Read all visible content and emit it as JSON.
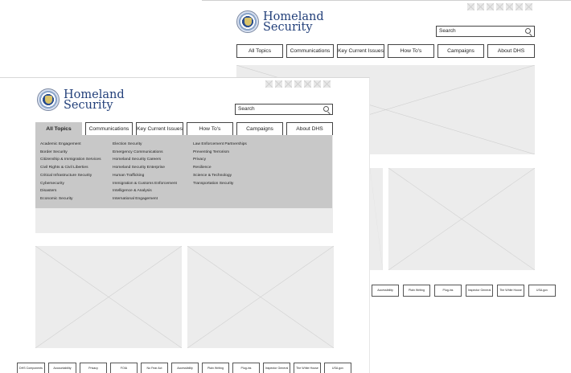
{
  "brand": {
    "line1": "Homeland",
    "line2": "Security"
  },
  "search": {
    "placeholder": "Search"
  },
  "nav": [
    "All Topics",
    "Communications",
    "Key Current Issues",
    "How To's",
    "Campaigns",
    "About DHS"
  ],
  "mega": {
    "col1": [
      "Academic Engagement",
      "Border Security",
      "Citizenship & Immigration Services",
      "Civil Rights & Civil Liberties",
      "Critical Infrastructure Security",
      "Cybersecurity",
      "Disasters",
      "Economic Security"
    ],
    "col2": [
      "Election Security",
      "Emergency Communications",
      "Homeland Security Careers",
      "Homeland Security Enterprise",
      "Human Trafficking",
      "Immigration & Customs Enforcement",
      "Intelligence & Analysis",
      "International Engagement"
    ],
    "col3": [
      "Law Enforcement Partnerships",
      "Preventing Terrorism",
      "Privacy",
      "Resilience",
      "Science & Technology",
      "Transportation Security"
    ]
  },
  "footer_front": [
    "DHS Components",
    "Accountability",
    "Privacy",
    "FOIA",
    "No Fear Act",
    "Accessibility",
    "Plain Writing",
    "Plug-ins",
    "Inspector General",
    "The White House",
    "USA.gov"
  ],
  "footer_back": [
    "Accessibility",
    "Plain Writing",
    "Plug-ins",
    "Inspector General",
    "The White House",
    "USA.gov"
  ],
  "colors": {
    "brand": "#23407a",
    "menu_bg": "#c8c8c8",
    "placeholder": "#ececec"
  }
}
